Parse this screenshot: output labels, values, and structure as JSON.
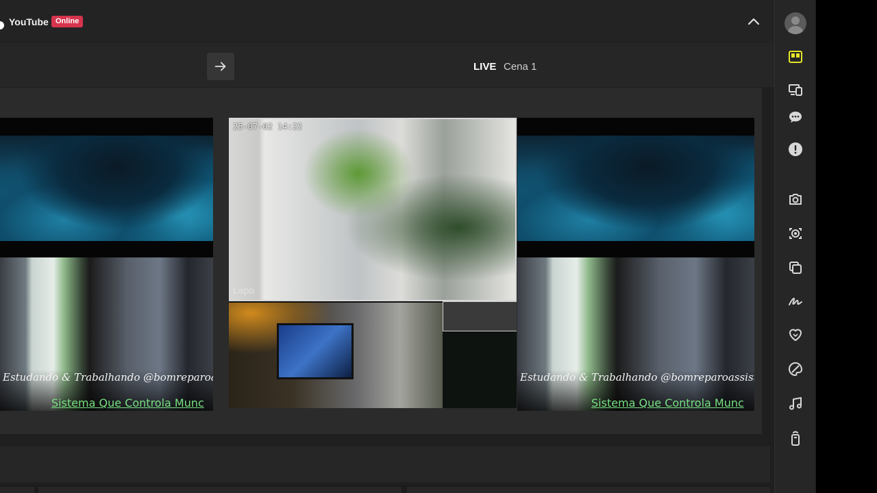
{
  "header": {
    "platform": "YouTube",
    "status_badge": "Online",
    "badge_color": "#d6344d"
  },
  "scene": {
    "live_label": "LIVE",
    "scene_name": "Cena 1"
  },
  "preview": {
    "camera_timestamp": "25-07-02 14:22",
    "camera_logo": "Lapo",
    "overlay_line1": "Estudando & Trabalhando @bomreparoassistenc",
    "overlay_line2": "Sistema Que Controla Munc",
    "overlay_line2_color": "#77e082"
  },
  "sidebar": {
    "accent_color": "#e6e629",
    "icons": [
      "layout-icon",
      "devices-icon",
      "chat-icon",
      "alert-icon",
      "camera-icon",
      "record-icon",
      "copy-icon",
      "signature-icon",
      "heart-icon",
      "palette-icon",
      "music-icon",
      "remote-icon"
    ]
  }
}
